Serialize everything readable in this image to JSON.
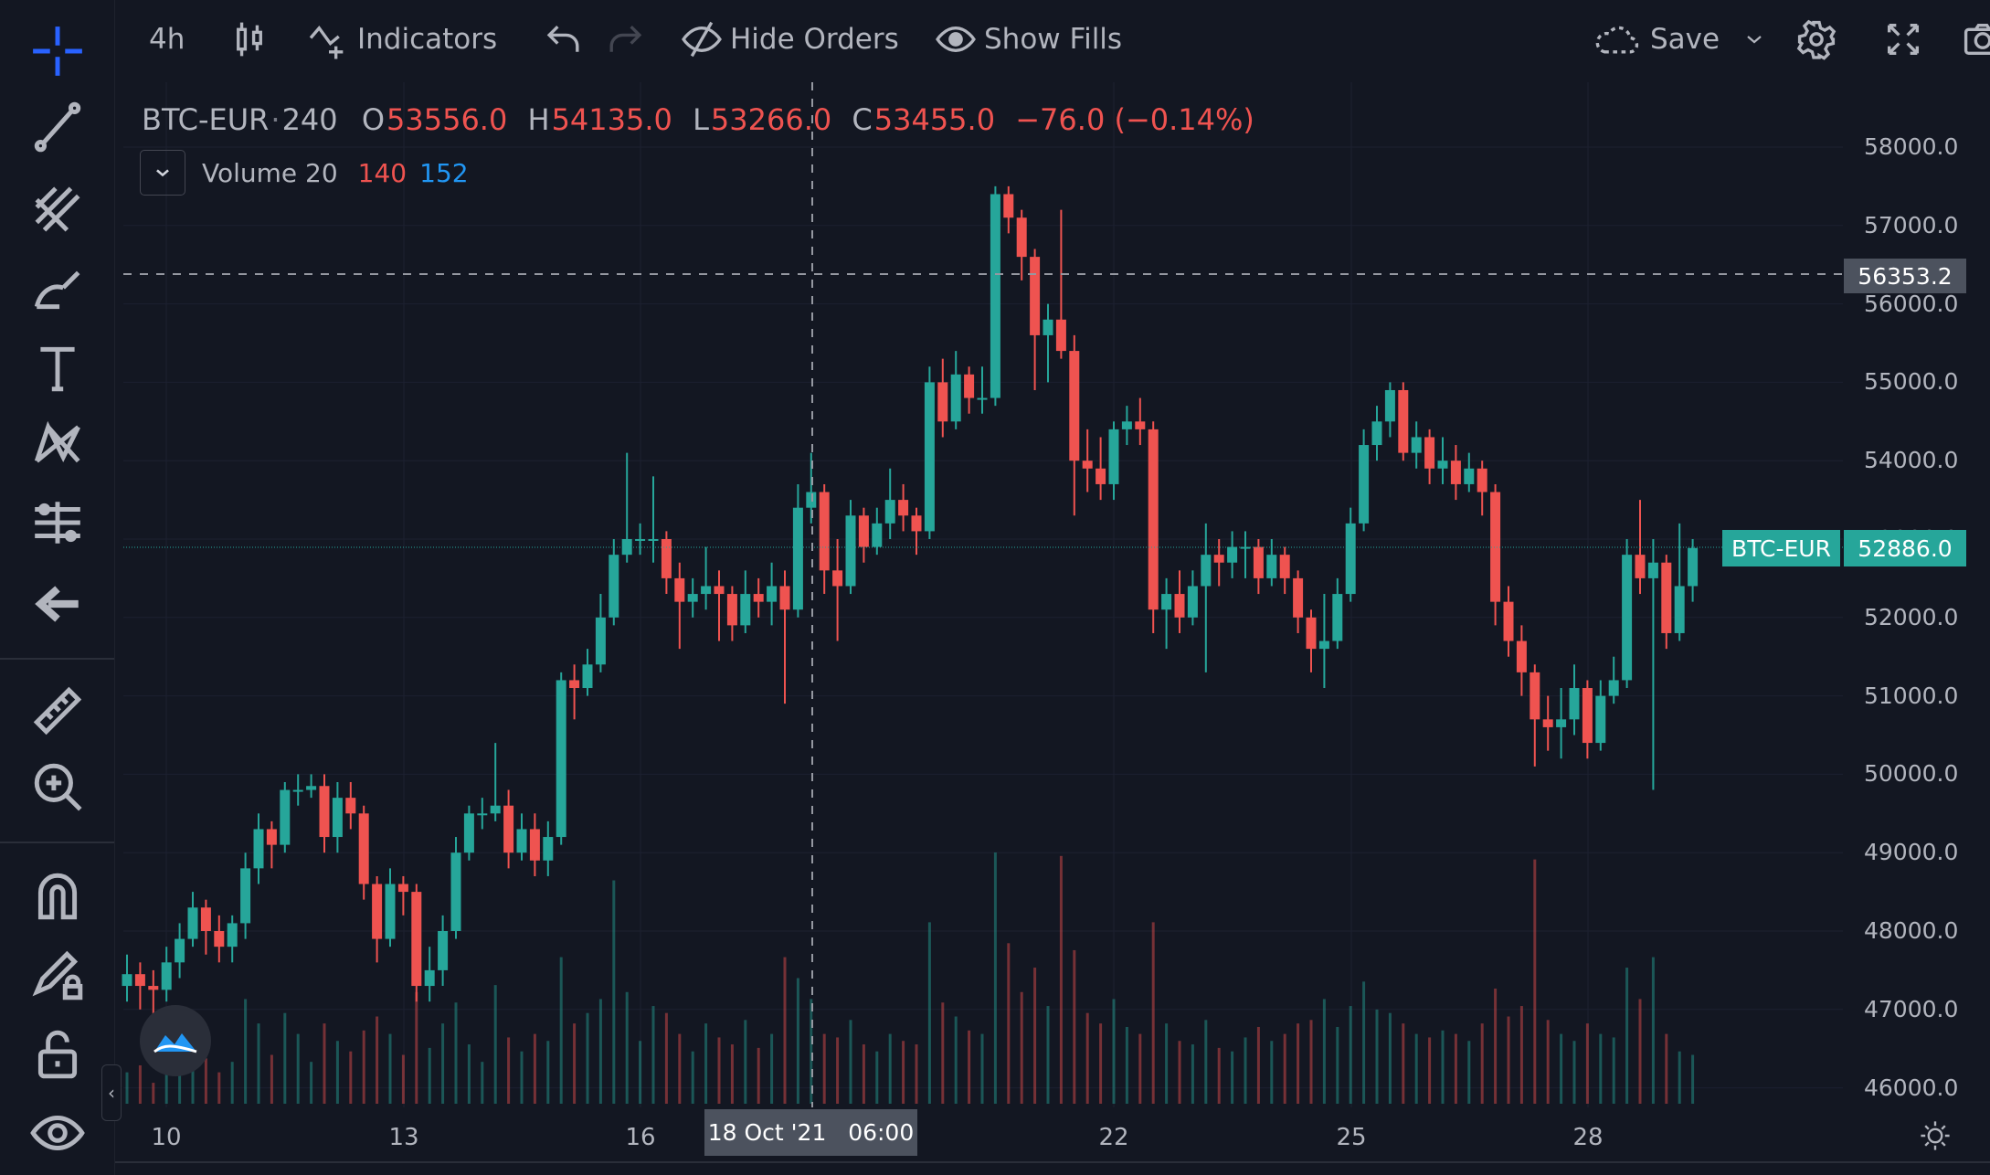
{
  "toolbar": {
    "interval": "4h",
    "indicators_label": "Indicators",
    "hide_orders_label": "Hide Orders",
    "show_fills_label": "Show Fills",
    "save_label": "Save"
  },
  "legend": {
    "symbol": "BTC-EUR",
    "separator": "·",
    "resolution": "240",
    "o_prefix": "O",
    "open": "53556.0",
    "h_prefix": "H",
    "high": "54135.0",
    "l_prefix": "L",
    "low": "53266.0",
    "c_prefix": "C",
    "close": "53455.0",
    "change": "−76.0 (−0.14%)",
    "volume_label": "Volume 20",
    "volume_value_1": "140",
    "volume_value_2": "152"
  },
  "colors": {
    "up": "#26a69a",
    "down": "#ef5350",
    "background": "#131722",
    "accent": "#2962ff"
  },
  "crosshair": {
    "price": "56353.2",
    "time": "18 Oct '21   06:00"
  },
  "last_price": {
    "symbol": "BTC-EUR",
    "price": "52886.0"
  },
  "price_axis": {
    "ticks": [
      "58000.0",
      "57000.0",
      "56000.0",
      "55000.0",
      "54000.0",
      "53000.0",
      "52000.0",
      "51000.0",
      "50000.0",
      "49000.0",
      "48000.0",
      "47000.0",
      "46000.0"
    ]
  },
  "time_axis": {
    "ticks": [
      "10",
      "13",
      "16",
      "22",
      "25",
      "28"
    ]
  },
  "chart_data": {
    "type": "candlestick",
    "xlabel": "",
    "ylabel": "",
    "ylim": [
      46000,
      58000
    ],
    "grid": true,
    "open": [
      47300,
      47450,
      47300,
      47250,
      47600,
      47900,
      48300,
      48000,
      47800,
      48100,
      48800,
      49300,
      49100,
      49800,
      49800,
      49850,
      49200,
      49700,
      49500,
      48600,
      47900,
      48600,
      48500,
      47300,
      47500,
      48000,
      49000,
      49500,
      49500,
      49600,
      49000,
      49300,
      48900,
      49200,
      51200,
      51100,
      51400,
      52000,
      52800,
      53000,
      53000,
      53000,
      52500,
      52200,
      52300,
      52400,
      52300,
      51900,
      52300,
      52200,
      52400,
      52100,
      53400,
      53600,
      52600,
      52400,
      53300,
      52900,
      53200,
      53500,
      53300,
      53100,
      55000,
      54500,
      55100,
      54800,
      54800,
      57400,
      57100,
      56600,
      55600,
      55800,
      55400,
      54000,
      53900,
      53700,
      54400,
      54500,
      54400,
      52100,
      52300,
      52000,
      52400,
      52800,
      52700,
      52900,
      52900,
      52500,
      52800,
      52500,
      52000,
      51600,
      51700,
      52300,
      53200,
      54200,
      54500,
      54900,
      54100,
      54300,
      53900,
      54000,
      53700,
      53900,
      53600,
      52200,
      51700,
      51300,
      50700,
      50600,
      50700,
      51100,
      50400,
      51000,
      51200,
      52800,
      52500,
      52700,
      51800,
      52400
    ],
    "high": [
      47700,
      47600,
      47500,
      47800,
      48100,
      48500,
      48400,
      48200,
      48200,
      49000,
      49500,
      49400,
      49900,
      50000,
      50000,
      50000,
      49900,
      49900,
      49600,
      48700,
      48800,
      48700,
      48600,
      47800,
      48200,
      49200,
      49600,
      49700,
      50400,
      49800,
      49500,
      49500,
      49400,
      51300,
      51400,
      51600,
      52300,
      53000,
      54100,
      53200,
      53800,
      53100,
      52700,
      52500,
      52900,
      52600,
      52400,
      52600,
      52500,
      52700,
      52600,
      53700,
      54100,
      53700,
      53000,
      53500,
      53400,
      53400,
      53900,
      53700,
      53400,
      55200,
      55300,
      55400,
      55200,
      55200,
      57500,
      57500,
      57200,
      56700,
      56000,
      57200,
      55600,
      54400,
      54300,
      54500,
      54700,
      54800,
      54500,
      52500,
      52600,
      52600,
      53200,
      53000,
      53100,
      53100,
      53000,
      53000,
      52900,
      52600,
      52100,
      52300,
      52500,
      53400,
      54400,
      54700,
      55000,
      55000,
      54500,
      54400,
      54300,
      54200,
      54100,
      54000,
      53700,
      52400,
      51900,
      51400,
      51000,
      51100,
      51400,
      51200,
      51200,
      51500,
      53000,
      53500,
      53000,
      52800,
      53200,
      53000
    ],
    "low": [
      47100,
      47000,
      46900,
      47100,
      47400,
      47800,
      47700,
      47600,
      47600,
      47900,
      48600,
      48800,
      49000,
      49600,
      49700,
      49000,
      49000,
      49300,
      48400,
      47600,
      47800,
      48200,
      47100,
      47100,
      47300,
      47900,
      48900,
      49300,
      49400,
      48800,
      48900,
      48700,
      48700,
      49100,
      50700,
      51000,
      51300,
      51900,
      52700,
      52800,
      52700,
      52300,
      51600,
      52000,
      52100,
      51700,
      51700,
      51800,
      52000,
      51900,
      50900,
      52000,
      53200,
      52300,
      51700,
      52300,
      52700,
      52800,
      53000,
      53100,
      52800,
      53000,
      54300,
      54400,
      54600,
      54600,
      54700,
      56900,
      56300,
      54900,
      55000,
      55300,
      53300,
      53600,
      53500,
      53500,
      54200,
      54200,
      51800,
      51600,
      51800,
      51900,
      51300,
      52400,
      52500,
      52500,
      52300,
      52400,
      52300,
      51800,
      51300,
      51100,
      51600,
      52200,
      53100,
      54000,
      54300,
      54000,
      53900,
      53700,
      53700,
      53500,
      53600,
      53300,
      51900,
      51500,
      51000,
      50100,
      50300,
      50200,
      50500,
      50200,
      50300,
      50900,
      51100,
      52300,
      49800,
      51600,
      51700,
      52200
    ],
    "close": [
      47450,
      47300,
      47250,
      47600,
      47900,
      48300,
      48000,
      47800,
      48100,
      48800,
      49300,
      49100,
      49800,
      49800,
      49850,
      49200,
      49700,
      49500,
      48600,
      47900,
      48600,
      48500,
      47300,
      47500,
      48000,
      49000,
      49500,
      49500,
      49600,
      49000,
      49300,
      48900,
      49200,
      51200,
      51100,
      51400,
      52000,
      52800,
      53000,
      53000,
      53000,
      52500,
      52200,
      52300,
      52400,
      52300,
      51900,
      52300,
      52200,
      52400,
      52100,
      53400,
      53600,
      52600,
      52400,
      53300,
      52900,
      53200,
      53500,
      53300,
      53100,
      55000,
      54500,
      55100,
      54800,
      54800,
      57400,
      57100,
      56600,
      55600,
      55800,
      55400,
      54000,
      53900,
      53700,
      54400,
      54500,
      54400,
      52100,
      52300,
      52000,
      52400,
      52800,
      52700,
      52900,
      52900,
      52500,
      52800,
      52500,
      52000,
      51600,
      51700,
      52300,
      53200,
      54200,
      54500,
      54900,
      54100,
      54300,
      53900,
      54000,
      53700,
      53900,
      53600,
      52200,
      51700,
      51300,
      50700,
      50600,
      50700,
      51100,
      50400,
      51000,
      51200,
      52800,
      52500,
      52700,
      51800,
      52400,
      52886
    ],
    "volume": [
      90,
      110,
      60,
      150,
      180,
      220,
      130,
      90,
      120,
      300,
      230,
      140,
      260,
      200,
      120,
      230,
      180,
      150,
      210,
      250,
      200,
      140,
      320,
      160,
      230,
      290,
      170,
      120,
      340,
      190,
      150,
      200,
      180,
      420,
      230,
      260,
      300,
      640,
      320,
      180,
      280,
      260,
      200,
      150,
      230,
      190,
      170,
      240,
      160,
      200,
      420,
      360,
      300,
      200,
      190,
      240,
      170,
      150,
      200,
      180,
      170,
      520,
      290,
      250,
      210,
      200,
      720,
      460,
      320,
      390,
      280,
      710,
      440,
      260,
      230,
      300,
      220,
      200,
      520,
      230,
      180,
      170,
      240,
      160,
      150,
      190,
      220,
      180,
      200,
      230,
      240,
      300,
      220,
      280,
      350,
      270,
      260,
      230,
      200,
      190,
      210,
      200,
      180,
      230,
      330,
      250,
      280,
      700,
      240,
      200,
      180,
      230,
      200,
      190,
      390,
      300,
      420,
      200,
      150,
      140
    ]
  }
}
